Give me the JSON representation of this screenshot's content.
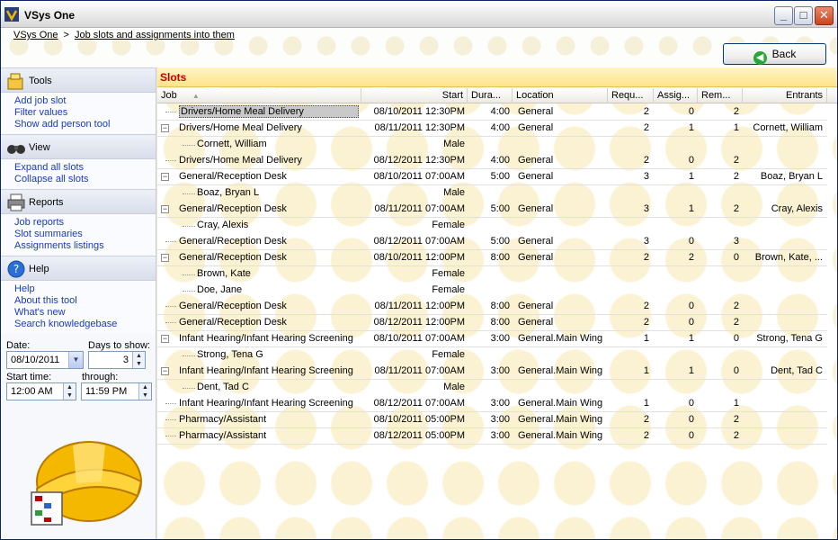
{
  "window": {
    "title": "VSys One"
  },
  "breadcrumb": {
    "home": "VSys One",
    "separator": ">",
    "current": "Job slots and assignments into them"
  },
  "back_button": {
    "label": "Back"
  },
  "sidebar": {
    "sections": [
      {
        "title": "Tools",
        "icon": "tools-icon",
        "links": [
          "Add job slot",
          "Filter values",
          "Show add person tool"
        ]
      },
      {
        "title": "View",
        "icon": "binoculars-icon",
        "links": [
          "Expand all slots",
          "Collapse all slots"
        ]
      },
      {
        "title": "Reports",
        "icon": "printer-icon",
        "links": [
          "Job reports",
          "Slot summaries",
          "Assignments listings"
        ]
      },
      {
        "title": "Help",
        "icon": "help-icon",
        "links": [
          "Help",
          "About this tool",
          "What's new",
          "Search knowledgebase"
        ]
      }
    ],
    "date_label": "Date:",
    "date_value": "08/10/2011",
    "days_label": "Days to show:",
    "days_value": "3",
    "start_label": "Start time:",
    "start_value": "12:00 AM",
    "through_label": "through:",
    "through_value": "11:59 PM"
  },
  "slots": {
    "title": "Slots",
    "columns": [
      "Job",
      "Start",
      "Dura...",
      "Location",
      "Requ...",
      "Assig...",
      "Rem...",
      "Entrants"
    ],
    "rows": [
      {
        "kind": "job",
        "toggle": "",
        "job": "Drivers/Home Meal Delivery",
        "start": "08/10/2011 12:30PM",
        "duration": "4:00",
        "location": "General",
        "required": "2",
        "assigned": "0",
        "remaining": "2",
        "entrants": ""
      },
      {
        "kind": "job",
        "toggle": "−",
        "job": "Drivers/Home Meal Delivery",
        "start": "08/11/2011 12:30PM",
        "duration": "4:00",
        "location": "General",
        "required": "2",
        "assigned": "1",
        "remaining": "1",
        "entrants": "Cornett, William"
      },
      {
        "kind": "person",
        "name": "Cornett, William",
        "gender": "Male"
      },
      {
        "kind": "job",
        "toggle": "",
        "job": "Drivers/Home Meal Delivery",
        "start": "08/12/2011 12:30PM",
        "duration": "4:00",
        "location": "General",
        "required": "2",
        "assigned": "0",
        "remaining": "2",
        "entrants": ""
      },
      {
        "kind": "job",
        "toggle": "−",
        "job": "General/Reception Desk",
        "start": "08/10/2011 07:00AM",
        "duration": "5:00",
        "location": "General",
        "required": "3",
        "assigned": "1",
        "remaining": "2",
        "entrants": "Boaz, Bryan L"
      },
      {
        "kind": "person",
        "name": "Boaz, Bryan L",
        "gender": "Male"
      },
      {
        "kind": "job",
        "toggle": "−",
        "job": "General/Reception Desk",
        "start": "08/11/2011 07:00AM",
        "duration": "5:00",
        "location": "General",
        "required": "3",
        "assigned": "1",
        "remaining": "2",
        "entrants": "Cray, Alexis"
      },
      {
        "kind": "person",
        "name": "Cray, Alexis",
        "gender": "Female"
      },
      {
        "kind": "job",
        "toggle": "",
        "job": "General/Reception Desk",
        "start": "08/12/2011 07:00AM",
        "duration": "5:00",
        "location": "General",
        "required": "3",
        "assigned": "0",
        "remaining": "3",
        "entrants": ""
      },
      {
        "kind": "job",
        "toggle": "−",
        "job": "General/Reception Desk",
        "start": "08/10/2011 12:00PM",
        "duration": "8:00",
        "location": "General",
        "required": "2",
        "assigned": "2",
        "remaining": "0",
        "entrants": "Brown, Kate, ..."
      },
      {
        "kind": "person",
        "name": "Brown, Kate",
        "gender": "Female"
      },
      {
        "kind": "person",
        "name": "Doe, Jane",
        "gender": "Female"
      },
      {
        "kind": "job",
        "toggle": "",
        "job": "General/Reception Desk",
        "start": "08/11/2011 12:00PM",
        "duration": "8:00",
        "location": "General",
        "required": "2",
        "assigned": "0",
        "remaining": "2",
        "entrants": ""
      },
      {
        "kind": "job",
        "toggle": "",
        "job": "General/Reception Desk",
        "start": "08/12/2011 12:00PM",
        "duration": "8:00",
        "location": "General",
        "required": "2",
        "assigned": "0",
        "remaining": "2",
        "entrants": ""
      },
      {
        "kind": "job",
        "toggle": "−",
        "job": "Infant Hearing/Infant Hearing Screening",
        "start": "08/10/2011 07:00AM",
        "duration": "3:00",
        "location": "General.Main Wing",
        "required": "1",
        "assigned": "1",
        "remaining": "0",
        "entrants": "Strong, Tena G"
      },
      {
        "kind": "person",
        "name": "Strong, Tena G",
        "gender": "Female"
      },
      {
        "kind": "job",
        "toggle": "−",
        "job": "Infant Hearing/Infant Hearing Screening",
        "start": "08/11/2011 07:00AM",
        "duration": "3:00",
        "location": "General.Main Wing",
        "required": "1",
        "assigned": "1",
        "remaining": "0",
        "entrants": "Dent, Tad C"
      },
      {
        "kind": "person",
        "name": "Dent, Tad C",
        "gender": "Male"
      },
      {
        "kind": "job",
        "toggle": "",
        "job": "Infant Hearing/Infant Hearing Screening",
        "start": "08/12/2011 07:00AM",
        "duration": "3:00",
        "location": "General.Main Wing",
        "required": "1",
        "assigned": "0",
        "remaining": "1",
        "entrants": ""
      },
      {
        "kind": "job",
        "toggle": "",
        "job": "Pharmacy/Assistant",
        "start": "08/10/2011 05:00PM",
        "duration": "3:00",
        "location": "General.Main Wing",
        "required": "2",
        "assigned": "0",
        "remaining": "2",
        "entrants": ""
      },
      {
        "kind": "job",
        "toggle": "",
        "job": "Pharmacy/Assistant",
        "start": "08/12/2011 05:00PM",
        "duration": "3:00",
        "location": "General.Main Wing",
        "required": "2",
        "assigned": "0",
        "remaining": "2",
        "entrants": ""
      }
    ]
  },
  "colors": {
    "slots_title": "#c00000",
    "link": "#1a3bb5",
    "accent_header": "#ffe48a"
  }
}
